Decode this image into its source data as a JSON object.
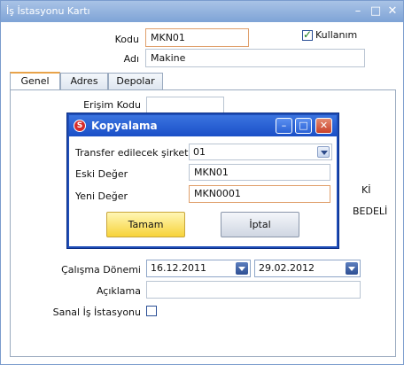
{
  "window": {
    "title": "İş İstasyonu Kartı",
    "min_icon": "minimize-icon",
    "max_icon": "maximize-icon",
    "close_icon": "close-icon"
  },
  "form": {
    "kodu_label": "Kodu",
    "kodu_value": "MKN01",
    "kullanim_label": "Kullanım",
    "kullanim_checked": true,
    "adi_label": "Adı",
    "adi_value": "Makine"
  },
  "tabs": [
    {
      "label": "Genel",
      "active": true
    },
    {
      "label": "Adres",
      "active": false
    },
    {
      "label": "Depolar",
      "active": false
    }
  ],
  "panel": {
    "erisim_kodu_label": "Erişim Kodu",
    "erisim_kodu_value": "",
    "partial_text_1": "Kİ",
    "partial_text_2": "BEDELİ",
    "calisma_donemi_label": "Çalışma Dönemi",
    "calisma_start": "16.12.2011",
    "calisma_end": "29.02.2012",
    "aciklama_label": "Açıklama",
    "aciklama_value": "",
    "sanal_label": "Sanal İş İstasyonu",
    "sanal_checked": false
  },
  "dialog": {
    "title": "Kopyalama",
    "app_icon": "app-logo-icon",
    "transfer_label": "Transfer edilecek şirket:",
    "transfer_value": "01",
    "eski_label": "Eski Değer",
    "eski_value": "MKN01",
    "yeni_label": "Yeni Değer",
    "yeni_value": "MKN0001",
    "ok_label": "Tamam",
    "cancel_label": "İptal"
  },
  "colors": {
    "title_bar": "#7ea3d6",
    "dialog_title": "#1a4fc7",
    "ok_button": "#f7d33a",
    "active_tab": "#e8a34a"
  }
}
